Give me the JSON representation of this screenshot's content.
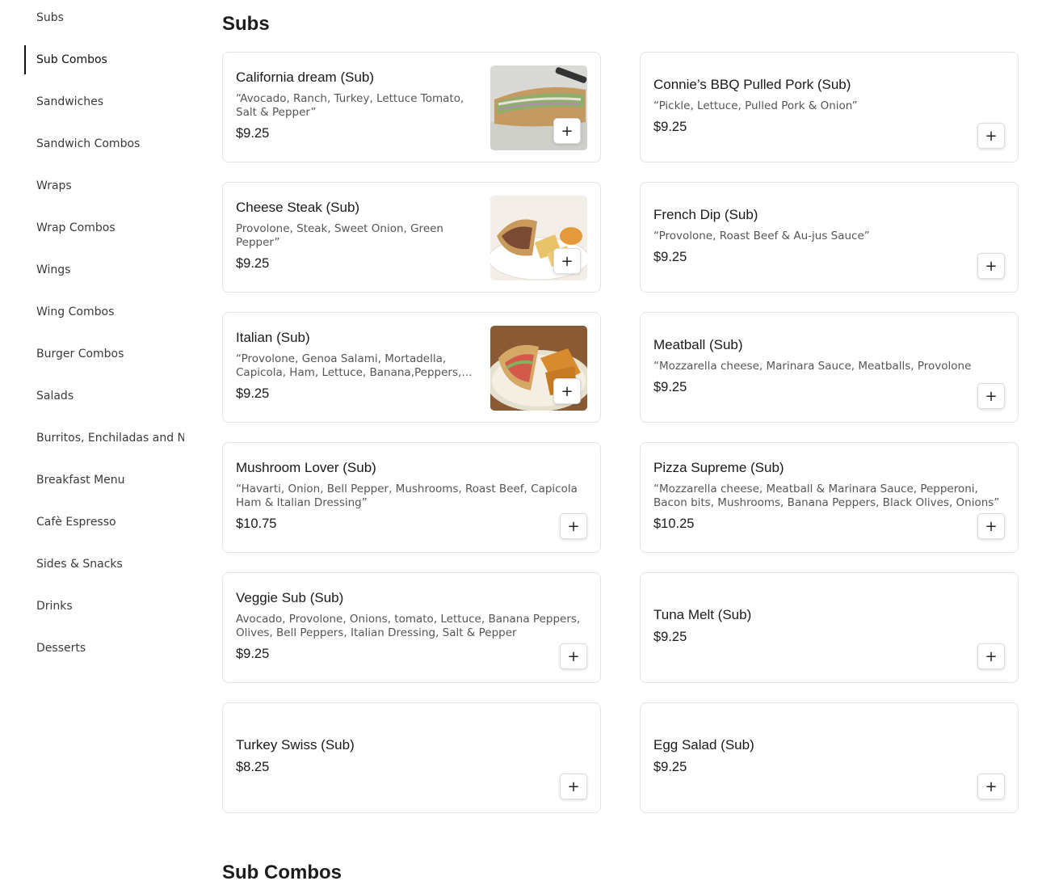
{
  "sidebar": {
    "items": [
      {
        "label": "Subs"
      },
      {
        "label": "Sub Combos"
      },
      {
        "label": "Sandwiches"
      },
      {
        "label": "Sandwich Combos"
      },
      {
        "label": "Wraps"
      },
      {
        "label": "Wrap Combos"
      },
      {
        "label": "Wings"
      },
      {
        "label": "Wing Combos"
      },
      {
        "label": "Burger Combos"
      },
      {
        "label": "Salads"
      },
      {
        "label": "Burritos, Enchiladas and Nachos"
      },
      {
        "label": "Breakfast Menu"
      },
      {
        "label": "Cafè Espresso"
      },
      {
        "label": "Sides & Snacks"
      },
      {
        "label": "Drinks"
      },
      {
        "label": "Desserts"
      }
    ],
    "active": "Sub Combos"
  },
  "main": {
    "section_title": "Subs",
    "next_section_title": "Sub Combos",
    "add_label": "+",
    "items": [
      {
        "name": "California dream (Sub)",
        "description": "“Avocado, Ranch, Turkey, Lettuce Tomato, Salt & Pepper”",
        "price": "$9.25",
        "image": "sub-sandwich-photo"
      },
      {
        "name": "Connie’s BBQ Pulled Pork (Sub)",
        "description": "“Pickle, Lettuce, Pulled Pork & Onion”",
        "price": "$9.25"
      },
      {
        "name": "Cheese Steak (Sub)",
        "description": "Provolone, Steak, Sweet Onion, Green Pepper”",
        "price": "$9.25",
        "image": "cheese-steak-photo"
      },
      {
        "name": "French Dip (Sub)",
        "description": "“Provolone, Roast Beef & Au-jus Sauce”",
        "price": "$9.25"
      },
      {
        "name": "Italian (Sub)",
        "description": "“Provolone, Genoa Salami, Mortadella, Capicola, Ham, Lettuce, Banana,Peppers, Olives, Tomatoes, Italian Dressing”",
        "price": "$9.25",
        "image": "italian-sub-photo"
      },
      {
        "name": "Meatball (Sub)",
        "description": "“Mozzarella cheese, Marinara Sauce, Meatballs, Provolone",
        "price": "$9.25"
      },
      {
        "name": "Mushroom Lover (Sub)",
        "description": "“Havarti, Onion, Bell Pepper, Mushrooms, Roast Beef, Capicola Ham & Italian Dressing”",
        "price": "$10.75"
      },
      {
        "name": "Pizza Supreme (Sub)",
        "description": "“Mozzarella cheese, Meatball & Marinara Sauce, Pepperoni, Bacon bits, Mushrooms, Banana Peppers, Black Olives, Onions”",
        "price": "$10.25"
      },
      {
        "name": "Veggie Sub (Sub)",
        "description": "Avocado, Provolone, Onions, tomato, Lettuce, Banana Peppers, Olives, Bell Peppers, Italian Dressing, Salt & Pepper",
        "price": "$9.25"
      },
      {
        "name": "Tuna Melt (Sub)",
        "description": "",
        "price": "$9.25"
      },
      {
        "name": "Turkey Swiss (Sub)",
        "description": "",
        "price": "$8.25"
      },
      {
        "name": "Egg Salad (Sub)",
        "description": "",
        "price": "$9.25"
      }
    ]
  }
}
